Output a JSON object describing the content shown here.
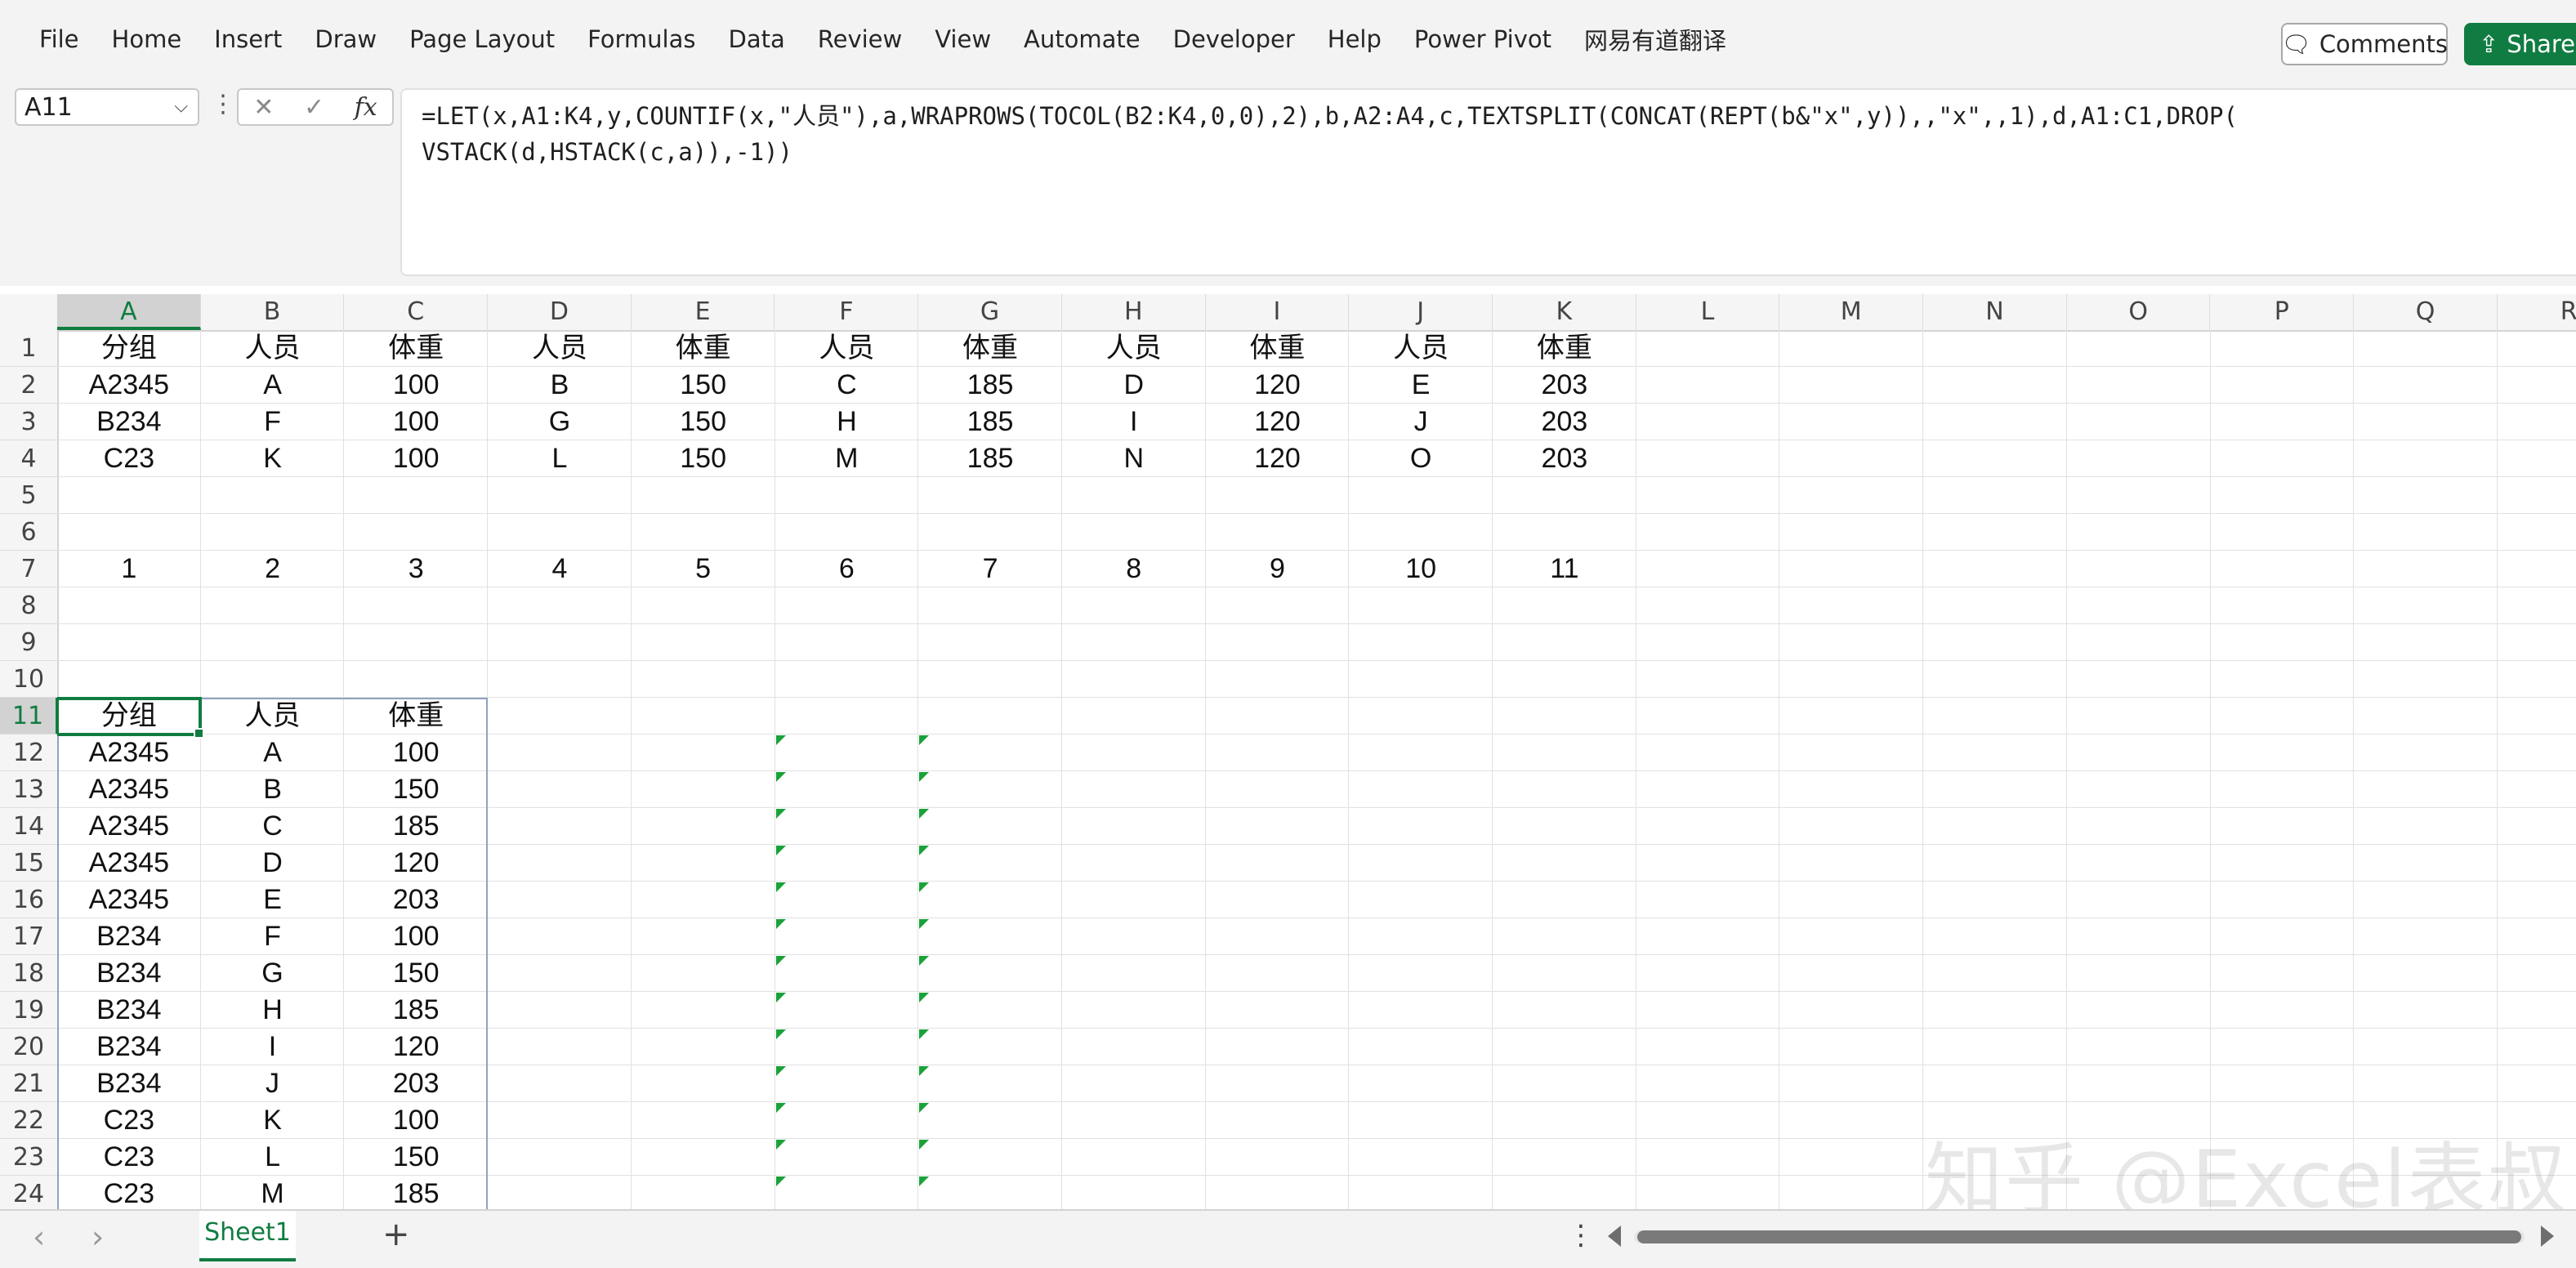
{
  "ribbon": {
    "menu": [
      "File",
      "Home",
      "Insert",
      "Draw",
      "Page Layout",
      "Formulas",
      "Data",
      "Review",
      "View",
      "Automate",
      "Developer",
      "Help",
      "Power Pivot",
      "网易有道翻译"
    ],
    "comments_label": "Comments",
    "share_label": "Share"
  },
  "formula_bar": {
    "name_box": "A11",
    "fx_symbol": "fx",
    "formula": "=LET(x,A1:K4,y,COUNTIF(x,\"人员\"),a,WRAPROWS(TOCOL(B2:K4,0,0),2),b,A2:A4,c,TEXTSPLIT(CONCAT(REPT(b&\"x\",y)),,\"x\",,1),d,A1:C1,DROP(\nVSTACK(d,HSTACK(c,a)),-1))"
  },
  "columns": [
    "A",
    "B",
    "C",
    "D",
    "E",
    "F",
    "G",
    "H",
    "I",
    "J",
    "K",
    "L",
    "M",
    "N",
    "O",
    "P",
    "Q",
    "R"
  ],
  "rows": [
    "1",
    "2",
    "3",
    "4",
    "5",
    "6",
    "7",
    "8",
    "9",
    "10",
    "11",
    "12",
    "13",
    "14",
    "15",
    "16",
    "17",
    "18",
    "19",
    "20",
    "21",
    "22",
    "23",
    "24"
  ],
  "active_col": "A",
  "active_row": "11",
  "table_top": [
    [
      "分组",
      "人员",
      "体重",
      "人员",
      "体重",
      "人员",
      "体重",
      "人员",
      "体重",
      "人员",
      "体重"
    ],
    [
      "A2345",
      "A",
      "100",
      "B",
      "150",
      "C",
      "185",
      "D",
      "120",
      "E",
      "203"
    ],
    [
      "B234",
      "F",
      "100",
      "G",
      "150",
      "H",
      "185",
      "I",
      "120",
      "J",
      "203"
    ],
    [
      "C23",
      "K",
      "100",
      "L",
      "150",
      "M",
      "185",
      "N",
      "120",
      "O",
      "203"
    ]
  ],
  "row7": [
    "1",
    "2",
    "3",
    "4",
    "5",
    "6",
    "7",
    "8",
    "9",
    "10",
    "11"
  ],
  "result_table": [
    [
      "分组",
      "人员",
      "体重"
    ],
    [
      "A2345",
      "A",
      "100"
    ],
    [
      "A2345",
      "B",
      "150"
    ],
    [
      "A2345",
      "C",
      "185"
    ],
    [
      "A2345",
      "D",
      "120"
    ],
    [
      "A2345",
      "E",
      "203"
    ],
    [
      "B234",
      "F",
      "100"
    ],
    [
      "B234",
      "G",
      "150"
    ],
    [
      "B234",
      "H",
      "185"
    ],
    [
      "B234",
      "I",
      "120"
    ],
    [
      "B234",
      "J",
      "203"
    ],
    [
      "C23",
      "K",
      "100"
    ],
    [
      "C23",
      "L",
      "150"
    ],
    [
      "C23",
      "M",
      "185"
    ]
  ],
  "watermark": "知乎 @Excel表叔",
  "sheet_tabs": [
    "Sheet1"
  ],
  "add_sheet_label": "+",
  "icons": {
    "comments": "comment-icon",
    "share": "share-icon",
    "name_box_dropdown": "chevron-down-icon",
    "cancel": "close-icon",
    "enter": "check-icon",
    "nav_prev": "chevron-left-icon",
    "nav_next": "chevron-right-icon"
  }
}
